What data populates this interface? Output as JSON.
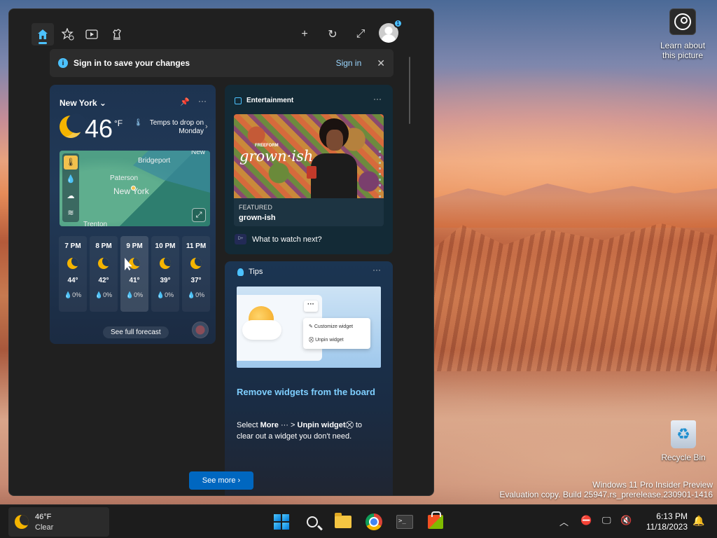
{
  "desktop": {
    "learn_label_1": "Learn about",
    "learn_label_2": "this picture",
    "recycle_label": "Recycle Bin",
    "watermark_line1": "Windows 11 Pro Insider Preview",
    "watermark_line2": "Evaluation copy. Build 25947.rs_prerelease.230901-1416"
  },
  "widgets": {
    "toolbar": {
      "home_icon": "home-icon",
      "favorites_icon": "star-add-icon",
      "video_icon": "play-icon",
      "games_icon": "chess-icon",
      "add_icon": "+",
      "refresh_icon": "↻",
      "expand_icon": "⤢",
      "notification_count": "1"
    },
    "signin": {
      "message": "Sign in to save your changes",
      "link": "Sign in",
      "close": "✕"
    },
    "weather": {
      "location": "New York",
      "temp": "46",
      "unit": "°F",
      "note": "Temps to drop on Monday",
      "map_labels": {
        "bridgeport": "Bridgeport",
        "paterson": "Paterson",
        "new_york": "New York",
        "trenton": "Trenton",
        "new_top": "New"
      },
      "hours": [
        {
          "time": "7 PM",
          "temp": "44°",
          "precip": "0%"
        },
        {
          "time": "8 PM",
          "temp": "42°",
          "precip": "0%"
        },
        {
          "time": "9 PM",
          "temp": "41°",
          "precip": "0%"
        },
        {
          "time": "10 PM",
          "temp": "39°",
          "precip": "0%"
        },
        {
          "time": "11 PM",
          "temp": "37°",
          "precip": "0%"
        }
      ],
      "forecast_button": "See full forecast"
    },
    "entertainment": {
      "header": "Entertainment",
      "poster_title": "grown·ish",
      "poster_brand": "FREEFORM",
      "caption_kicker": "FEATURED",
      "caption_title": "grown-ish",
      "what_next": "What to watch next?"
    },
    "tips": {
      "header": "Tips",
      "menu_customize": "Customize widget",
      "menu_unpin": "Unpin widget",
      "title": "Remove widgets from the board",
      "desc_pre": "Select ",
      "desc_more": "More",
      "desc_mid": " ··· > ",
      "desc_unpin": "Unpin widget",
      "desc_post": "⛒ to clear out a widget you don't need."
    },
    "see_more": "See more"
  },
  "taskbar": {
    "weather_temp": "46°F",
    "weather_cond": "Clear",
    "time": "6:13 PM",
    "date": "11/18/2023"
  }
}
